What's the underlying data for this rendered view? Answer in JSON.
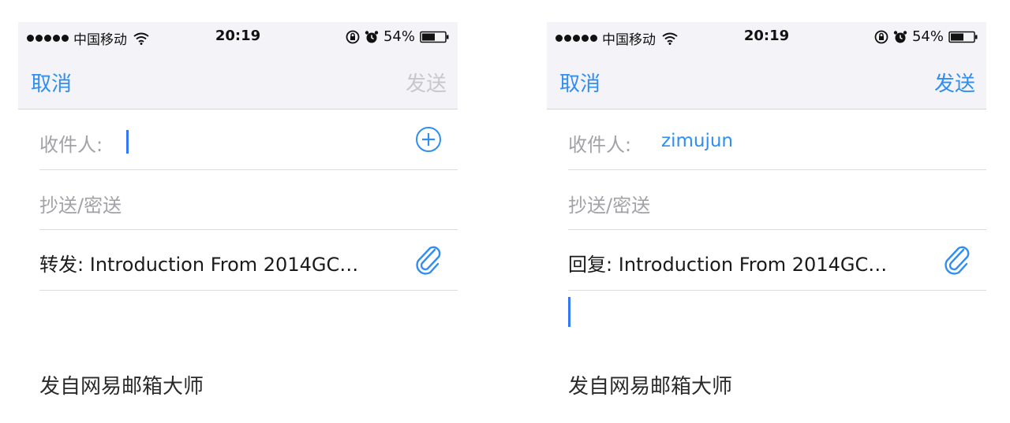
{
  "screens": [
    {
      "status": {
        "carrier": "中国移动",
        "time": "20:19",
        "battery": "54%"
      },
      "nav": {
        "cancel": "取消",
        "send": "发送",
        "send_enabled": false
      },
      "to": {
        "label": "收件人:",
        "value": ""
      },
      "cc": {
        "label": "抄送/密送"
      },
      "subject": {
        "prefix": "转发:",
        "text": "Introduction From 2014GC…"
      },
      "signature": "发自网易邮箱大师"
    },
    {
      "status": {
        "carrier": "中国移动",
        "time": "20:19",
        "battery": "54%"
      },
      "nav": {
        "cancel": "取消",
        "send": "发送",
        "send_enabled": true
      },
      "to": {
        "label": "收件人:",
        "value": "zimujun"
      },
      "cc": {
        "label": "抄送/密送"
      },
      "subject": {
        "prefix": "回复:",
        "text": "Introduction From 2014GC…"
      },
      "signature": "发自网易邮箱大师"
    }
  ],
  "colors": {
    "accent": "#2f8ef0",
    "caret": "#3478f6",
    "placeholder": "#a2a2a7",
    "disabled": "#c7c7cc",
    "bar": "#f4f4f8"
  },
  "icons": [
    "signal-dots-icon",
    "wifi-icon",
    "rotation-lock-icon",
    "alarm-icon",
    "battery-icon",
    "add-contact-icon",
    "paperclip-icon"
  ]
}
